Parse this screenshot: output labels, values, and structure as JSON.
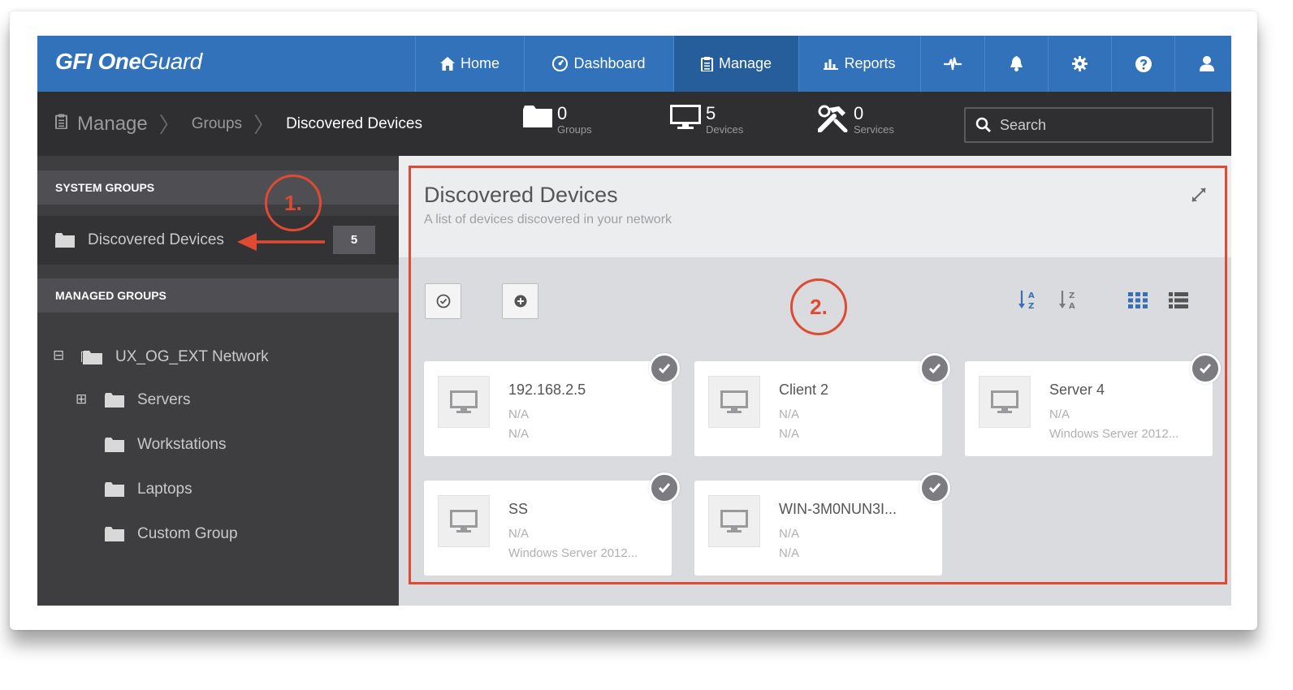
{
  "app": {
    "logo_gfi": "GFI",
    "logo_one": " One",
    "logo_guard": "Guard"
  },
  "nav": {
    "home": "Home",
    "dashboard": "Dashboard",
    "manage": "Manage",
    "reports": "Reports",
    "icons": [
      "activity-icon",
      "bell-icon",
      "gear-icon",
      "help-icon",
      "user-icon"
    ]
  },
  "breadcrumb": {
    "root": "Manage",
    "middle": "Groups",
    "current": "Discovered Devices"
  },
  "stats": {
    "groups": {
      "value": "0",
      "label": "Groups"
    },
    "devices": {
      "value": "5",
      "label": "Devices"
    },
    "services": {
      "value": "0",
      "label": "Services"
    }
  },
  "search": {
    "placeholder": "Search"
  },
  "sidebar": {
    "system_groups_heading": "SYSTEM GROUPS",
    "discovered_label": "Discovered Devices",
    "discovered_count": "5",
    "managed_groups_heading": "MANAGED GROUPS",
    "network": {
      "toggle": "⊟",
      "label": "UX_OG_EXT Network"
    },
    "servers": {
      "toggle": "⊞",
      "label": "Servers"
    },
    "workstations": "Workstations",
    "laptops": "Laptops",
    "custom_group": "Custom Group"
  },
  "panel": {
    "title": "Discovered Devices",
    "subtitle": "A list of devices discovered in your network"
  },
  "devices": [
    {
      "name": "192.168.2.5",
      "line1": "N/A",
      "line2": "N/A"
    },
    {
      "name": "Client 2",
      "line1": "N/A",
      "line2": "N/A"
    },
    {
      "name": "Server 4",
      "line1": "N/A",
      "line2": "Windows Server 2012..."
    },
    {
      "name": "SS",
      "line1": "N/A",
      "line2": "Windows Server 2012..."
    },
    {
      "name": "WIN-3M0NUN3I...",
      "line1": "N/A",
      "line2": "N/A"
    }
  ],
  "annotations": {
    "one": "1.",
    "two": "2.",
    "color": "#e04a33"
  },
  "colors": {
    "topbar": "#3172bb",
    "subbar": "#2f2f31",
    "sidebar": "#3e3e41",
    "accent_icon": "#3a6fb6"
  }
}
